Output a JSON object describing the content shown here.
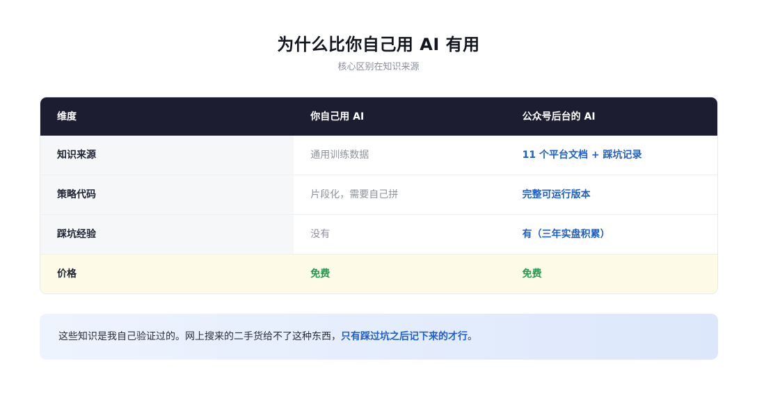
{
  "title": "为什么比你自己用 AI 有用",
  "subtitle": "核心区别在知识来源",
  "table": {
    "headers": [
      "维度",
      "你自己用 AI",
      "公众号后台的 AI"
    ],
    "rows": [
      [
        "知识来源",
        "通用训练数据",
        "11 个平台文档 + 踩坑记录"
      ],
      [
        "策略代码",
        "片段化，需要自己拼",
        "完整可运行版本"
      ],
      [
        "踩坑经验",
        "没有",
        "有（三年实盘积累）"
      ],
      [
        "价格",
        "免费",
        "免费"
      ]
    ]
  },
  "note": {
    "text": "这些知识是我自己验证过的。网上搜来的二手货给不了这种东西，",
    "highlight": "只有踩过坑之后记下来的才行",
    "end": "。"
  },
  "colors": {
    "header_bg": "#1c1d31",
    "accent_blue": "#1f5fcc",
    "accent_green": "#1f9a4a",
    "price_row_bg": "#fefae8"
  }
}
